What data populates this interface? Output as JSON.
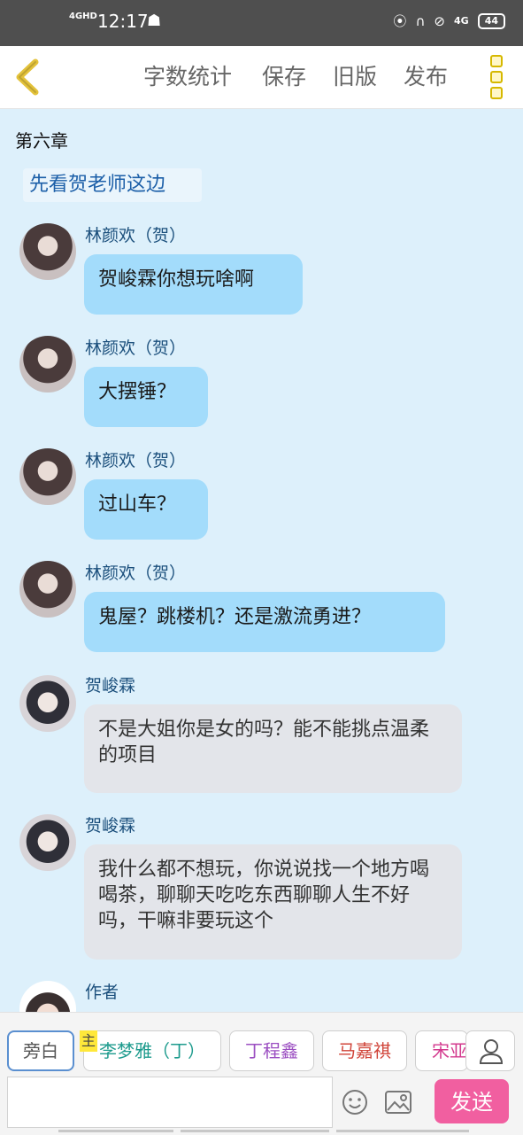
{
  "status_bar": {
    "network": "4GHD",
    "time": "12:17",
    "cell": "4G",
    "battery": "44"
  },
  "toolbar": {
    "word_count": "字数统计",
    "save": "保存",
    "old_version": "旧版",
    "publish": "发布"
  },
  "chat": {
    "chapter_title": "第六章",
    "narration": "先看贺老师这边",
    "messages": [
      {
        "speaker": "林颜欢（贺）",
        "text": "贺峻霖你想玩啥啊"
      },
      {
        "speaker": "林颜欢（贺）",
        "text": "大摆锤？"
      },
      {
        "speaker": "林颜欢（贺）",
        "text": "过山车？"
      },
      {
        "speaker": "林颜欢（贺）",
        "text": "鬼屋？跳楼机？还是激流勇进？"
      },
      {
        "speaker": "贺峻霖",
        "text": "不是大姐你是女的吗？能不能挑点温柔的项目"
      },
      {
        "speaker": "贺峻霖",
        "text": "我什么都不想玩，你说说找一个地方喝喝茶，聊聊天吃吃东西聊聊人生不好吗，干嘛非要玩这个"
      },
      {
        "speaker": "作者",
        "text": ""
      }
    ]
  },
  "bottom": {
    "narration_chip": "旁白",
    "main_badge": "主",
    "characters": [
      "李梦雅（丁）",
      "丁程鑫",
      "马嘉祺",
      "宋亚"
    ],
    "input_value": "",
    "send": "发送"
  }
}
